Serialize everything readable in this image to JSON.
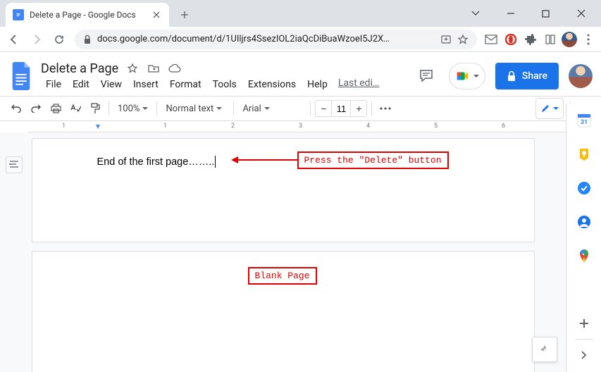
{
  "browser": {
    "tab_title": "Delete a Page - Google Docs",
    "url": "docs.google.com/document/d/1UIljrs4SsezIOL2iaQcDiBuaWzoeI5J2X…"
  },
  "doc": {
    "title": "Delete a Page",
    "menus": [
      "File",
      "Edit",
      "View",
      "Insert",
      "Format",
      "Tools",
      "Extensions",
      "Help"
    ],
    "last_edit": "Last edi…",
    "share_label": "Share"
  },
  "toolbar": {
    "zoom": "100%",
    "style": "Normal text",
    "font": "Arial",
    "font_size": "11"
  },
  "ruler": {
    "marks": [
      "1",
      "1",
      "2",
      "3",
      "4",
      "5",
      "6"
    ]
  },
  "content": {
    "line1": "End of the first page…….."
  },
  "annotations": {
    "delete_hint": "Press the \"Delete\" button",
    "blank_page": "Blank Page"
  }
}
